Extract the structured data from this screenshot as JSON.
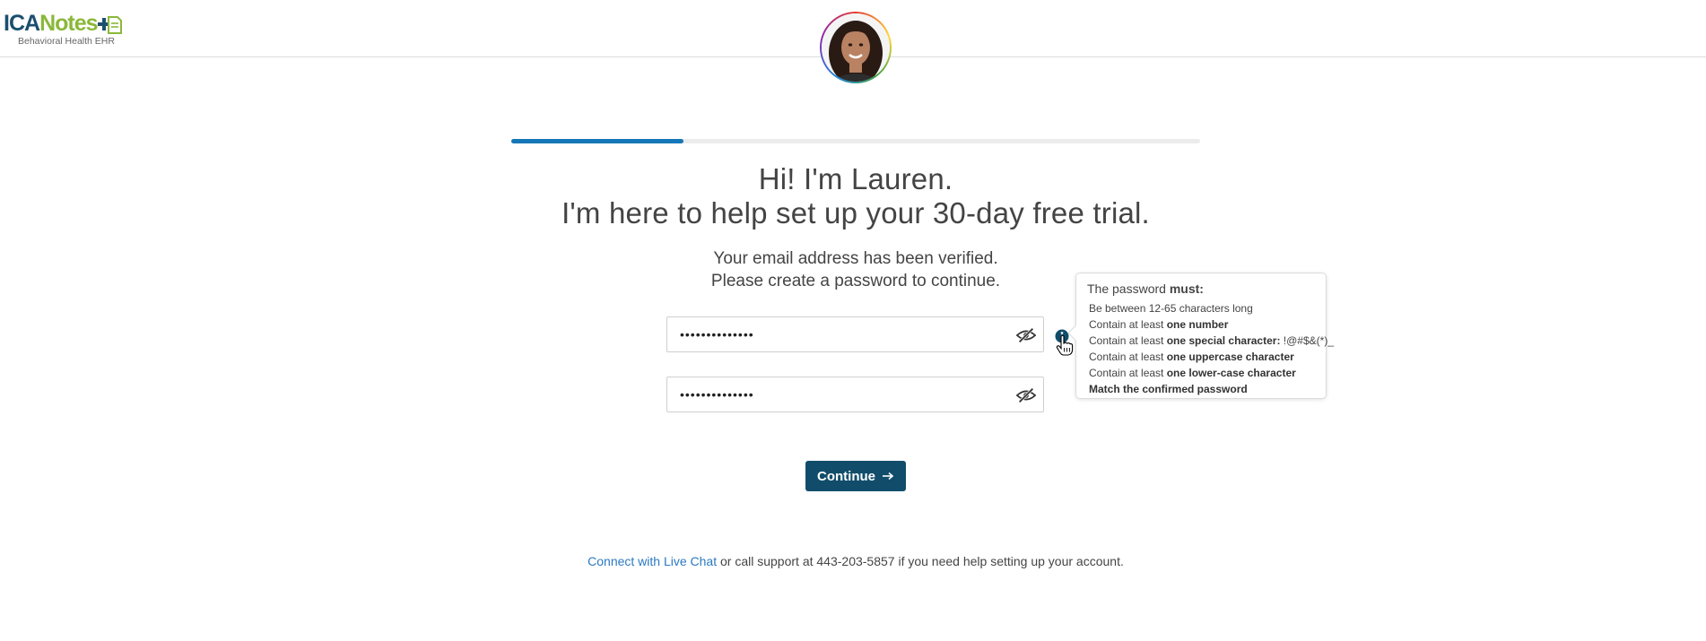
{
  "header": {
    "logo": {
      "ica": "ICA",
      "notes": "Notes",
      "tagline": "Behavioral Health EHR"
    }
  },
  "progress": {
    "value": 0.25
  },
  "intro": {
    "title_line1": "Hi! I'm Lauren.",
    "title_line2": "I'm here to help set up your 30-day free trial.",
    "subtitle_line1": "Your email address has been verified.",
    "subtitle_line2": "Please create a password to continue."
  },
  "form": {
    "password_value": "••••••••••••••",
    "confirm_value": "••••••••••••••"
  },
  "tooltip": {
    "head_prefix": "The password ",
    "head_bold": "must:",
    "rules": [
      {
        "text": "Be between 12-65 characters long",
        "bold": "",
        "after": ""
      },
      {
        "text": "Contain at least ",
        "bold": "one number",
        "after": ""
      },
      {
        "text": "Contain at least ",
        "bold": "one special character:",
        "after": " !@#$&(*)_"
      },
      {
        "text": "Contain at least ",
        "bold": "one uppercase character",
        "after": ""
      },
      {
        "text": "Contain at least ",
        "bold": "one lower-case character",
        "after": ""
      },
      {
        "text": "",
        "bold": "Match the confirmed password",
        "after": ""
      }
    ]
  },
  "actions": {
    "continue_label": "Continue"
  },
  "support": {
    "link_text": "Connect with Live Chat",
    "rest_text": " or call support at 443-203-5857 if you need help setting up your account."
  },
  "colors": {
    "brand_dark": "#114d6b",
    "brand_green": "#8ab83a",
    "progress_blue": "#1577b8",
    "link_blue": "#2b79c2"
  },
  "icons": [
    "icanotes-logo-icon",
    "avatar-photo",
    "eye-slash-icon",
    "info-icon",
    "hand-pointer-icon",
    "arrow-right-icon"
  ]
}
